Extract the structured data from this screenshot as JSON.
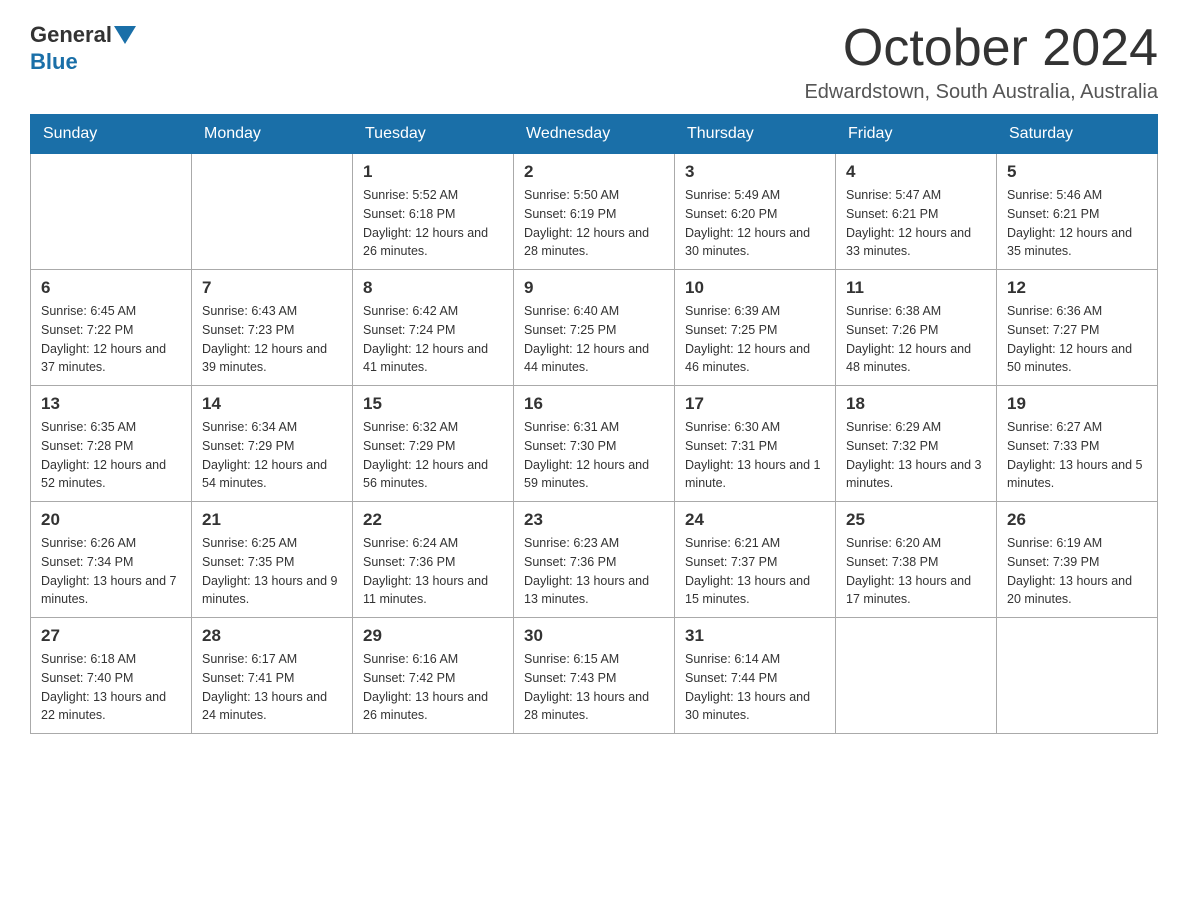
{
  "header": {
    "logo_general": "General",
    "logo_blue": "Blue",
    "month_title": "October 2024",
    "location": "Edwardstown, South Australia, Australia"
  },
  "days_of_week": [
    "Sunday",
    "Monday",
    "Tuesday",
    "Wednesday",
    "Thursday",
    "Friday",
    "Saturday"
  ],
  "weeks": [
    [
      {
        "day": "",
        "info": ""
      },
      {
        "day": "",
        "info": ""
      },
      {
        "day": "1",
        "info": "Sunrise: 5:52 AM\nSunset: 6:18 PM\nDaylight: 12 hours\nand 26 minutes."
      },
      {
        "day": "2",
        "info": "Sunrise: 5:50 AM\nSunset: 6:19 PM\nDaylight: 12 hours\nand 28 minutes."
      },
      {
        "day": "3",
        "info": "Sunrise: 5:49 AM\nSunset: 6:20 PM\nDaylight: 12 hours\nand 30 minutes."
      },
      {
        "day": "4",
        "info": "Sunrise: 5:47 AM\nSunset: 6:21 PM\nDaylight: 12 hours\nand 33 minutes."
      },
      {
        "day": "5",
        "info": "Sunrise: 5:46 AM\nSunset: 6:21 PM\nDaylight: 12 hours\nand 35 minutes."
      }
    ],
    [
      {
        "day": "6",
        "info": "Sunrise: 6:45 AM\nSunset: 7:22 PM\nDaylight: 12 hours\nand 37 minutes."
      },
      {
        "day": "7",
        "info": "Sunrise: 6:43 AM\nSunset: 7:23 PM\nDaylight: 12 hours\nand 39 minutes."
      },
      {
        "day": "8",
        "info": "Sunrise: 6:42 AM\nSunset: 7:24 PM\nDaylight: 12 hours\nand 41 minutes."
      },
      {
        "day": "9",
        "info": "Sunrise: 6:40 AM\nSunset: 7:25 PM\nDaylight: 12 hours\nand 44 minutes."
      },
      {
        "day": "10",
        "info": "Sunrise: 6:39 AM\nSunset: 7:25 PM\nDaylight: 12 hours\nand 46 minutes."
      },
      {
        "day": "11",
        "info": "Sunrise: 6:38 AM\nSunset: 7:26 PM\nDaylight: 12 hours\nand 48 minutes."
      },
      {
        "day": "12",
        "info": "Sunrise: 6:36 AM\nSunset: 7:27 PM\nDaylight: 12 hours\nand 50 minutes."
      }
    ],
    [
      {
        "day": "13",
        "info": "Sunrise: 6:35 AM\nSunset: 7:28 PM\nDaylight: 12 hours\nand 52 minutes."
      },
      {
        "day": "14",
        "info": "Sunrise: 6:34 AM\nSunset: 7:29 PM\nDaylight: 12 hours\nand 54 minutes."
      },
      {
        "day": "15",
        "info": "Sunrise: 6:32 AM\nSunset: 7:29 PM\nDaylight: 12 hours\nand 56 minutes."
      },
      {
        "day": "16",
        "info": "Sunrise: 6:31 AM\nSunset: 7:30 PM\nDaylight: 12 hours\nand 59 minutes."
      },
      {
        "day": "17",
        "info": "Sunrise: 6:30 AM\nSunset: 7:31 PM\nDaylight: 13 hours\nand 1 minute."
      },
      {
        "day": "18",
        "info": "Sunrise: 6:29 AM\nSunset: 7:32 PM\nDaylight: 13 hours\nand 3 minutes."
      },
      {
        "day": "19",
        "info": "Sunrise: 6:27 AM\nSunset: 7:33 PM\nDaylight: 13 hours\nand 5 minutes."
      }
    ],
    [
      {
        "day": "20",
        "info": "Sunrise: 6:26 AM\nSunset: 7:34 PM\nDaylight: 13 hours\nand 7 minutes."
      },
      {
        "day": "21",
        "info": "Sunrise: 6:25 AM\nSunset: 7:35 PM\nDaylight: 13 hours\nand 9 minutes."
      },
      {
        "day": "22",
        "info": "Sunrise: 6:24 AM\nSunset: 7:36 PM\nDaylight: 13 hours\nand 11 minutes."
      },
      {
        "day": "23",
        "info": "Sunrise: 6:23 AM\nSunset: 7:36 PM\nDaylight: 13 hours\nand 13 minutes."
      },
      {
        "day": "24",
        "info": "Sunrise: 6:21 AM\nSunset: 7:37 PM\nDaylight: 13 hours\nand 15 minutes."
      },
      {
        "day": "25",
        "info": "Sunrise: 6:20 AM\nSunset: 7:38 PM\nDaylight: 13 hours\nand 17 minutes."
      },
      {
        "day": "26",
        "info": "Sunrise: 6:19 AM\nSunset: 7:39 PM\nDaylight: 13 hours\nand 20 minutes."
      }
    ],
    [
      {
        "day": "27",
        "info": "Sunrise: 6:18 AM\nSunset: 7:40 PM\nDaylight: 13 hours\nand 22 minutes."
      },
      {
        "day": "28",
        "info": "Sunrise: 6:17 AM\nSunset: 7:41 PM\nDaylight: 13 hours\nand 24 minutes."
      },
      {
        "day": "29",
        "info": "Sunrise: 6:16 AM\nSunset: 7:42 PM\nDaylight: 13 hours\nand 26 minutes."
      },
      {
        "day": "30",
        "info": "Sunrise: 6:15 AM\nSunset: 7:43 PM\nDaylight: 13 hours\nand 28 minutes."
      },
      {
        "day": "31",
        "info": "Sunrise: 6:14 AM\nSunset: 7:44 PM\nDaylight: 13 hours\nand 30 minutes."
      },
      {
        "day": "",
        "info": ""
      },
      {
        "day": "",
        "info": ""
      }
    ]
  ]
}
